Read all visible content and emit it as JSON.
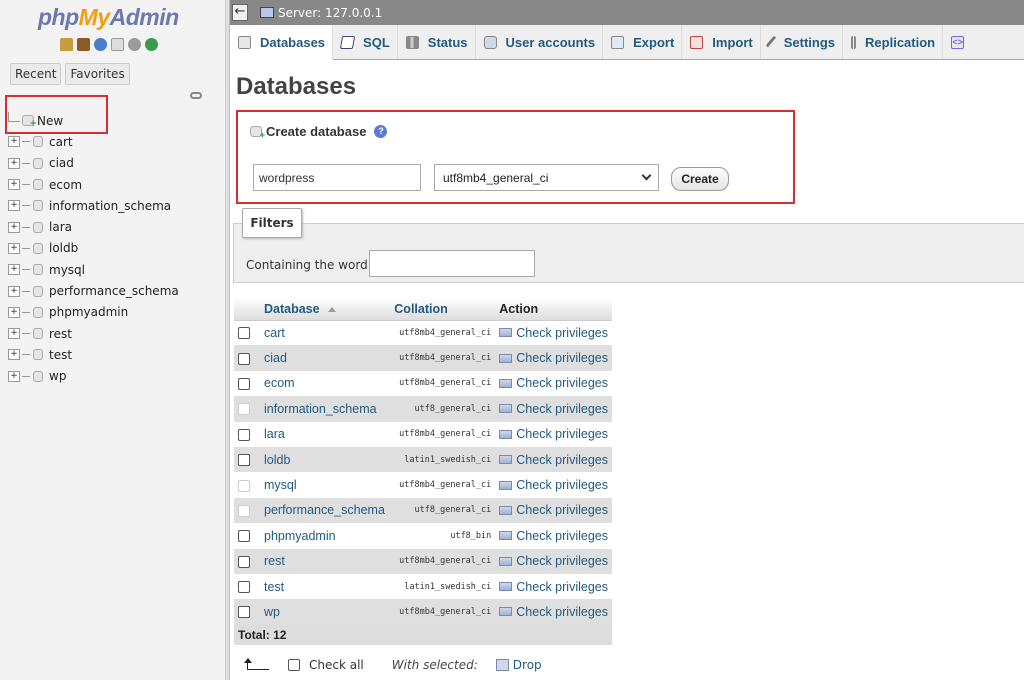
{
  "nav": {
    "logo_php": "php",
    "logo_my": "My",
    "logo_admin": "Admin",
    "tabs": [
      "Recent",
      "Favorites"
    ],
    "new_label": "New",
    "databases": [
      "cart",
      "ciad",
      "ecom",
      "information_schema",
      "lara",
      "loldb",
      "mysql",
      "performance_schema",
      "phpmyadmin",
      "rest",
      "test",
      "wp"
    ]
  },
  "serverbar": {
    "collapse": "←",
    "label": "Server: 127.0.0.1"
  },
  "menu": [
    {
      "label": "Databases",
      "icon": "database-icon"
    },
    {
      "label": "SQL",
      "icon": "sql-icon"
    },
    {
      "label": "Status",
      "icon": "status-icon"
    },
    {
      "label": "User accounts",
      "icon": "users-icon"
    },
    {
      "label": "Export",
      "icon": "export-icon"
    },
    {
      "label": "Import",
      "icon": "import-icon"
    },
    {
      "label": "Settings",
      "icon": "settings-icon"
    },
    {
      "label": "Replication",
      "icon": "replication-icon"
    }
  ],
  "page": {
    "title": "Databases",
    "create_heading": "Create database",
    "db_name_value": "wordpress",
    "collation_value": "utf8mb4_general_ci",
    "create_button": "Create"
  },
  "filters": {
    "legend": "Filters",
    "label": "Containing the word:"
  },
  "table": {
    "headers": {
      "database": "Database",
      "collation": "Collation",
      "action": "Action"
    },
    "action_label": "Check privileges",
    "rows": [
      {
        "name": "cart",
        "collation": "utf8mb4_general_ci",
        "system": false
      },
      {
        "name": "ciad",
        "collation": "utf8mb4_general_ci",
        "system": false
      },
      {
        "name": "ecom",
        "collation": "utf8mb4_general_ci",
        "system": false
      },
      {
        "name": "information_schema",
        "collation": "utf8_general_ci",
        "system": true
      },
      {
        "name": "lara",
        "collation": "utf8mb4_general_ci",
        "system": false
      },
      {
        "name": "loldb",
        "collation": "latin1_swedish_ci",
        "system": false
      },
      {
        "name": "mysql",
        "collation": "utf8mb4_general_ci",
        "system": true
      },
      {
        "name": "performance_schema",
        "collation": "utf8_general_ci",
        "system": true
      },
      {
        "name": "phpmyadmin",
        "collation": "utf8_bin",
        "system": false
      },
      {
        "name": "rest",
        "collation": "utf8mb4_general_ci",
        "system": false
      },
      {
        "name": "test",
        "collation": "latin1_swedish_ci",
        "system": false
      },
      {
        "name": "wp",
        "collation": "utf8mb4_general_ci",
        "system": false
      }
    ],
    "total": "Total: 12"
  },
  "footer": {
    "check_all": "Check all",
    "with_selected": "With selected:",
    "drop": "Drop"
  },
  "colors": {
    "link": "#235a81",
    "highlight_border": "#d32f2f"
  }
}
